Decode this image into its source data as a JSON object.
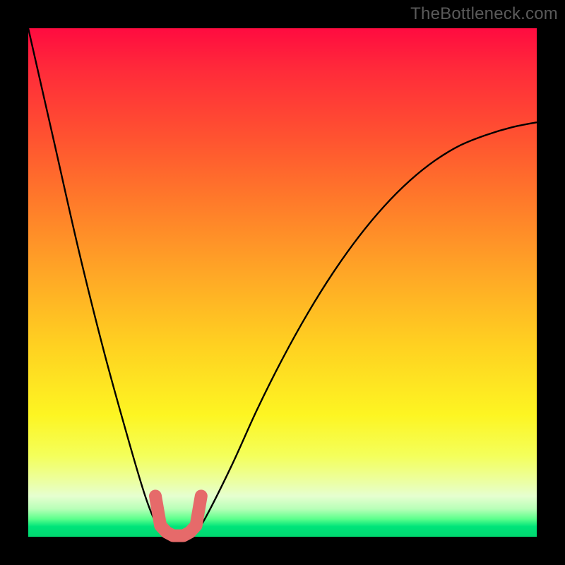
{
  "watermark": "TheBottleneck.com",
  "colors": {
    "frame": "#000000",
    "curve": "#000000",
    "valley_marker": "#e66a6a",
    "watermark": "#5a5a5a"
  },
  "chart_data": {
    "type": "line",
    "title": "",
    "xlabel": "",
    "ylabel": "",
    "xlim": [
      0,
      100
    ],
    "ylim": [
      0,
      100
    ],
    "grid": false,
    "legend": false,
    "background": "vertical rainbow gradient (red → orange → yellow → green)",
    "series": [
      {
        "name": "bottleneck-curve",
        "x": [
          0,
          5,
          10,
          15,
          20,
          23,
          25,
          27,
          28,
          29,
          30,
          31,
          32,
          33,
          35,
          40,
          45,
          50,
          55,
          60,
          65,
          70,
          75,
          80,
          85,
          90,
          95,
          100
        ],
        "y": [
          100,
          78,
          56,
          36,
          18,
          8,
          3,
          1,
          0.5,
          0,
          0,
          0,
          0.5,
          1,
          4,
          14,
          25,
          35,
          44,
          52,
          59,
          65,
          70,
          74,
          77,
          79,
          80.5,
          81.5
        ]
      }
    ],
    "annotations": [
      {
        "name": "valley-highlight",
        "x_range": [
          25,
          34
        ],
        "y_range": [
          0,
          5
        ],
        "note": "pink thick U-shaped marker at curve minimum"
      }
    ]
  }
}
